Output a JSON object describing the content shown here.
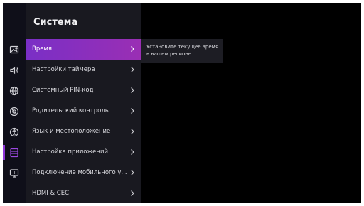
{
  "panel": {
    "title": "Система",
    "items": [
      {
        "label": "Время"
      },
      {
        "label": "Настройки таймера"
      },
      {
        "label": "Системный PIN-код"
      },
      {
        "label": "Родительский контроль"
      },
      {
        "label": "Язык и местоположение"
      },
      {
        "label": "Настройка приложений"
      },
      {
        "label": "Подключение мобильного у..."
      },
      {
        "label": "HDMI & CEC"
      }
    ]
  },
  "tooltip": {
    "text": "Установите текущее время в вашем регионе."
  },
  "sidebar_icons": [
    {
      "name": "picture-icon"
    },
    {
      "name": "sound-icon"
    },
    {
      "name": "network-icon"
    },
    {
      "name": "accessibility-icon"
    },
    {
      "name": "person-icon"
    },
    {
      "name": "system-icon",
      "active": true
    },
    {
      "name": "support-icon"
    }
  ],
  "colors": {
    "accent": "#8e36d6",
    "selected_gradient_start": "#7a2fc6",
    "selected_gradient_end": "#9a2fb4"
  }
}
